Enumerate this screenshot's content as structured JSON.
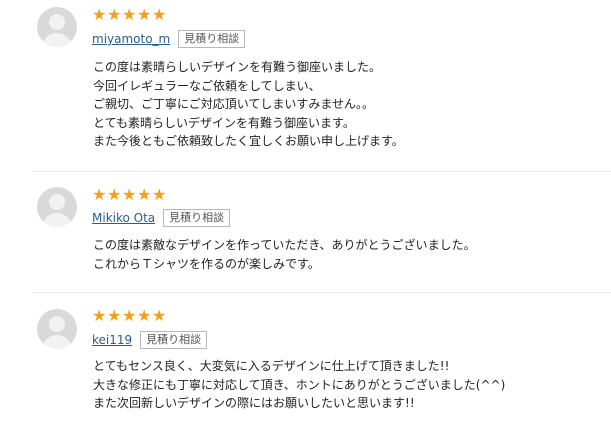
{
  "reviews": [
    {
      "stars": [
        "★",
        "★",
        "★",
        "★",
        "★"
      ],
      "username": "miyamoto_m",
      "badge": "見積り相談",
      "lines": [
        "この度は素晴らしいデザインを有難う御座いました。",
        "今回イレギュラーなご依頼をしてしまい、",
        "ご親切、ご丁寧にご対応頂いてしまいすみません。。",
        "とても素晴らしいデザインを有難う御座います。",
        "また今後ともご依頼致したく宜しくお願い申し上げます。"
      ]
    },
    {
      "stars": [
        "★",
        "★",
        "★",
        "★",
        "★"
      ],
      "username": "Mikiko Ota",
      "badge": "見積り相談",
      "lines": [
        "この度は素敵なデザインを作っていただき、ありがとうございました。",
        "これからＴシャツを作るのが楽しみです。"
      ]
    },
    {
      "stars": [
        "★",
        "★",
        "★",
        "★",
        "★"
      ],
      "username": "kei119",
      "badge": "見積り相談",
      "lines": [
        "とてもセンス良く、大変気に入るデザインに仕上げて頂きました!!",
        "大きな修正にも丁寧に対応して頂き、ホントにありがとうございました(^^)",
        "また次回新しいデザインの際にはお願いしたいと思います!!"
      ]
    }
  ],
  "colors": {
    "star": "#f5a01a",
    "username": "#2a5d8f",
    "divider": "#e6e6e6"
  },
  "icons": {
    "avatar": "user-silhouette-icon",
    "star": "star-icon"
  }
}
